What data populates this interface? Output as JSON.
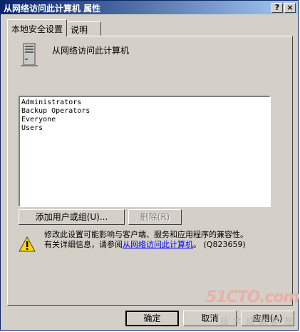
{
  "window": {
    "title": "从网络访问此计算机 属性"
  },
  "title_buttons": {
    "help": "?",
    "close": "×"
  },
  "tabs": [
    {
      "label": "本地安全设置",
      "active": true
    },
    {
      "label": "说明",
      "active": false
    }
  ],
  "policy": {
    "name": "从网络访问此计算机",
    "icon": "server-icon"
  },
  "members": [
    "Administrators",
    "Backup Operators",
    "Everyone",
    "Users"
  ],
  "actions": {
    "add_label": "添加用户或组(U)...",
    "remove_label": "删除(R)"
  },
  "warning": {
    "icon": "warning-icon",
    "line1": "修改此设置可能影响与客户端、服务和应用程序的兼容性。",
    "line2_prefix": "有关详细信息，请参阅",
    "link_text": "从网络访问此计算机",
    "line2_suffix": "。 (Q823659)"
  },
  "footer": {
    "ok_label": "确定",
    "cancel_label": "取消",
    "apply_label": "应用(A)"
  },
  "watermark": {
    "logo": "51CTO.com",
    "sub": "技术成就梦想"
  },
  "colors": {
    "titlebar_start": "#0a246a",
    "titlebar_end": "#a6caf0",
    "face": "#d4d0c8",
    "link": "#0000ee"
  }
}
